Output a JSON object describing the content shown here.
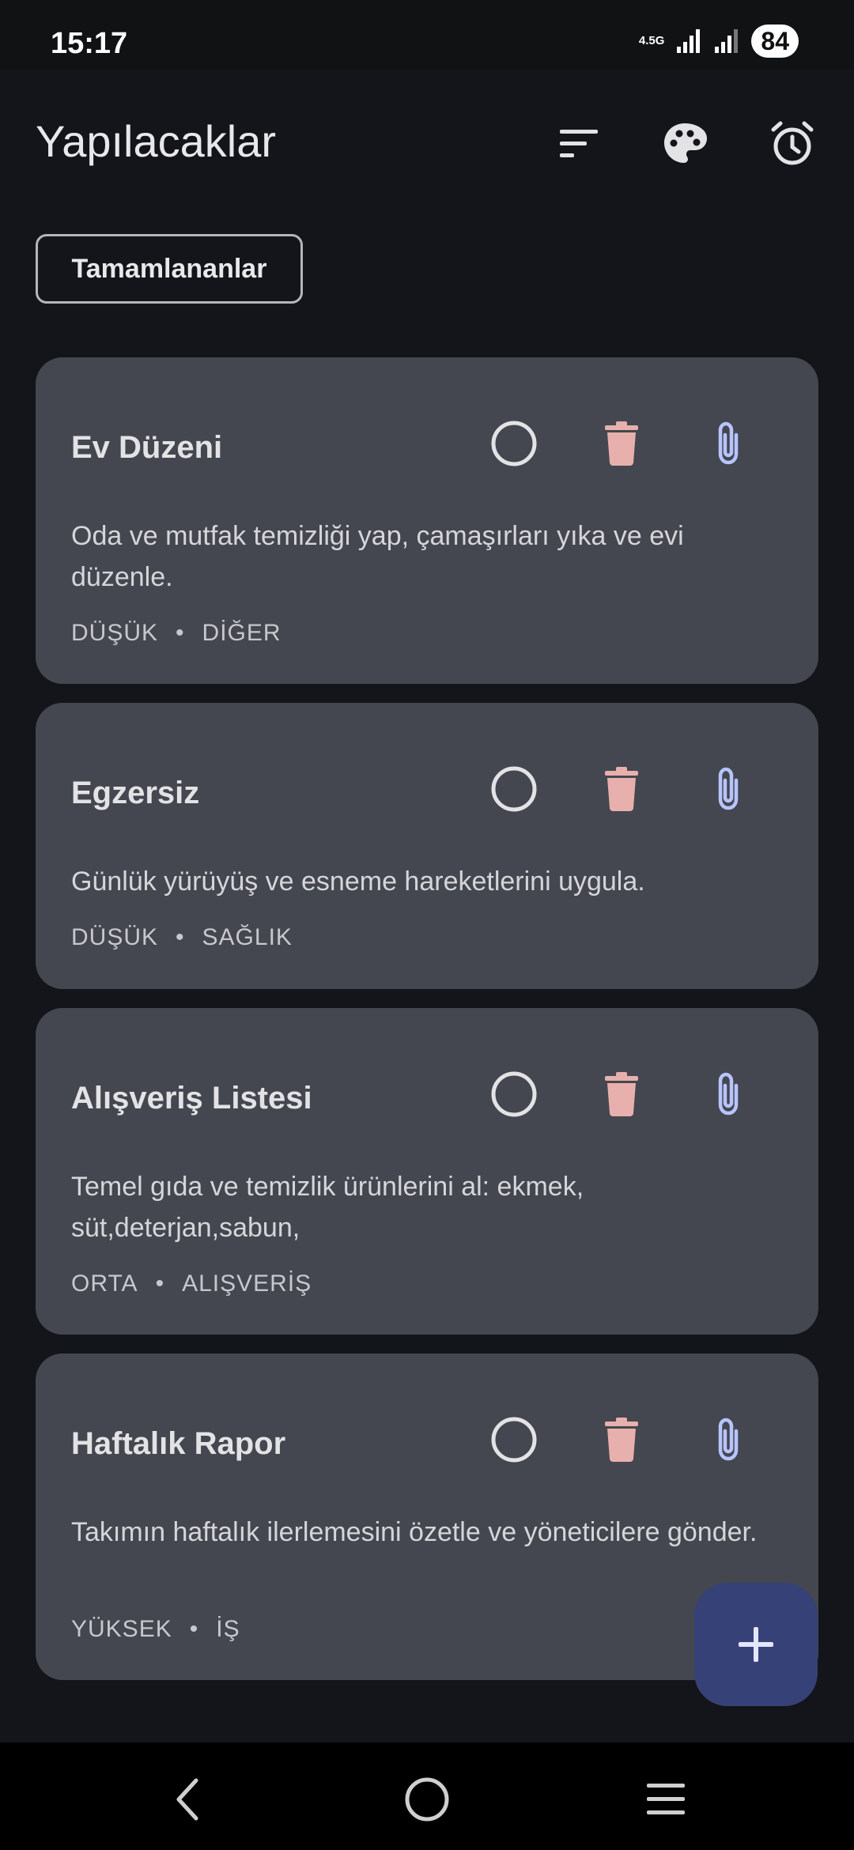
{
  "status_bar": {
    "time": "15:17",
    "network": "4.5G",
    "battery": "84"
  },
  "app_bar": {
    "title": "Yapılacaklar",
    "icons": [
      "sort-icon",
      "palette-icon",
      "alarm-icon"
    ]
  },
  "filter": {
    "completed_label": "Tamamlananlar"
  },
  "tasks": [
    {
      "title": "Ev Düzeni",
      "description": "Oda ve mutfak temizliği yap, çamaşırları yıka ve evi düzenle.",
      "priority": "DÜŞÜK",
      "category": "DİĞER"
    },
    {
      "title": "Egzersiz",
      "description": "Günlük yürüyüş ve esneme hareketlerini uygula.",
      "priority": "DÜŞÜK",
      "category": "SAĞLIK"
    },
    {
      "title": "Alışveriş Listesi",
      "description": "Temel gıda ve temizlik ürünlerini al: ekmek, süt,deterjan,sabun,",
      "priority": "ORTA",
      "category": "ALIŞVERİŞ"
    },
    {
      "title": "Haftalık Rapor",
      "description": "Takımın haftalık ilerlemesini özetle ve yöneticilere gönder.",
      "priority": "YÜKSEK",
      "category": "İŞ"
    }
  ],
  "meta_separator": "•",
  "fab": {
    "icon": "plus-icon"
  },
  "colors": {
    "background": "#13151a",
    "card": "#44474f",
    "delete": "#e8b0ad",
    "attach": "#b8c4ff",
    "fab": "#364177"
  }
}
